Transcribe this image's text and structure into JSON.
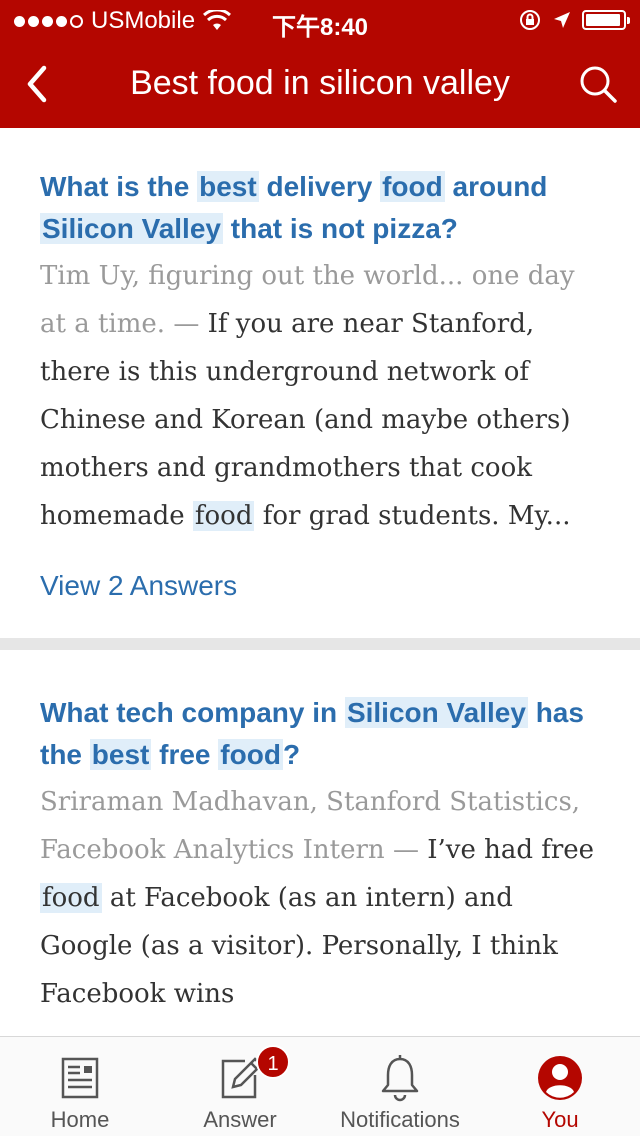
{
  "status_bar": {
    "carrier": "USMobile",
    "time": "下午8:40"
  },
  "nav": {
    "title": "Best food in silicon valley"
  },
  "results": [
    {
      "title_parts": [
        {
          "text": "What is the ",
          "hl": false
        },
        {
          "text": "best",
          "hl": true
        },
        {
          "text": " delivery ",
          "hl": false
        },
        {
          "text": "food",
          "hl": true
        },
        {
          "text": " around ",
          "hl": false
        },
        {
          "text": "Silicon Valley",
          "hl": true
        },
        {
          "text": " that is not pizza?",
          "hl": false
        }
      ],
      "author": "Tim Uy, figuring out the world... one day at a time.",
      "separator": " — ",
      "excerpt_parts": [
        {
          "text": "If you are near Stanford, there is this underground network of Chinese and Korean (and maybe others) mothers and grandmothers that cook homemade ",
          "hl": false
        },
        {
          "text": "food",
          "hl": true
        },
        {
          "text": " for grad students.  My...",
          "hl": false
        }
      ],
      "view_answers": "View 2 Answers"
    },
    {
      "title_parts": [
        {
          "text": "What tech company in ",
          "hl": false
        },
        {
          "text": "Silicon Valley",
          "hl": true
        },
        {
          "text": " has the ",
          "hl": false
        },
        {
          "text": "best",
          "hl": true
        },
        {
          "text": " free ",
          "hl": false
        },
        {
          "text": "food",
          "hl": true
        },
        {
          "text": "?",
          "hl": false
        }
      ],
      "author": "Sriraman Madhavan, Stanford Statistics, Facebook Analytics Intern",
      "separator": " — ",
      "excerpt_parts": [
        {
          "text": "I’ve had free ",
          "hl": false
        },
        {
          "text": "food",
          "hl": true
        },
        {
          "text": " at Facebook (as an intern) and Google (as a visitor). Personally, I think Facebook wins",
          "hl": false
        }
      ]
    }
  ],
  "tabbar": {
    "home": "Home",
    "answer": "Answer",
    "answer_badge": "1",
    "notifications": "Notifications",
    "you": "You"
  },
  "colors": {
    "brand": "#b40600",
    "link": "#2b6dad",
    "highlight": "#e0eef9"
  }
}
